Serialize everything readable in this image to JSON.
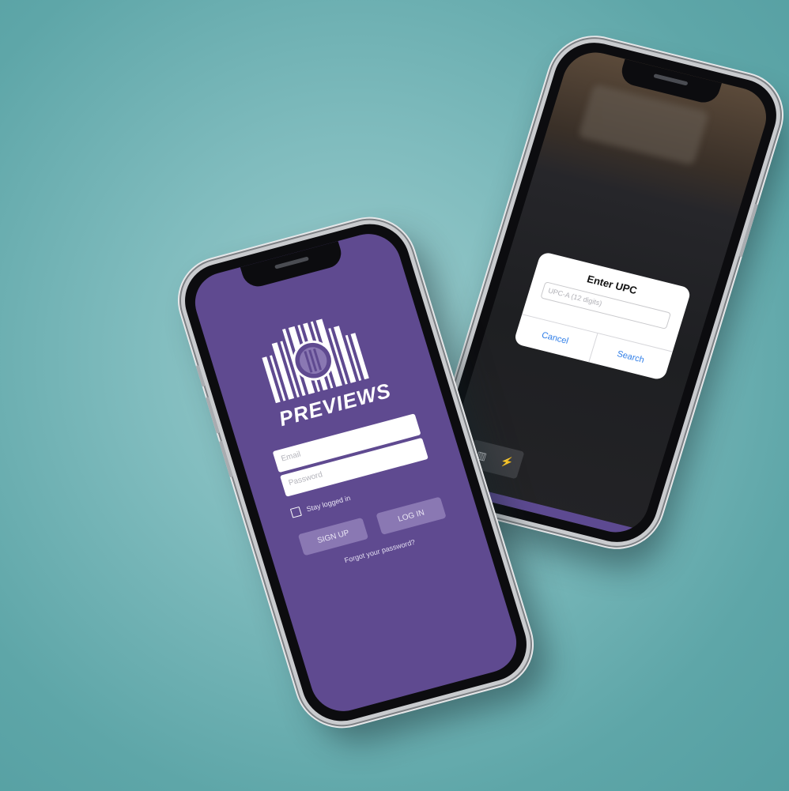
{
  "background": {
    "color": "#6cb1b3"
  },
  "scanner_phone": {
    "dialog": {
      "title": "Enter UPC",
      "input_placeholder": "UPC-A (12 digits)",
      "cancel_label": "Cancel",
      "search_label": "Search"
    },
    "toolbar": {
      "barcode_icon": "▥",
      "flash_icon": "⚡"
    }
  },
  "login_phone": {
    "brand_name": "PREVIEWS",
    "email_placeholder": "Email",
    "password_placeholder": "Password",
    "stay_logged_in_label": "Stay logged in",
    "signup_label": "SIGN UP",
    "login_label": "LOG IN",
    "forgot_password_label": "Forgot your password?",
    "colors": {
      "primary": "#5f4a90",
      "button": "#8a78b3"
    }
  }
}
